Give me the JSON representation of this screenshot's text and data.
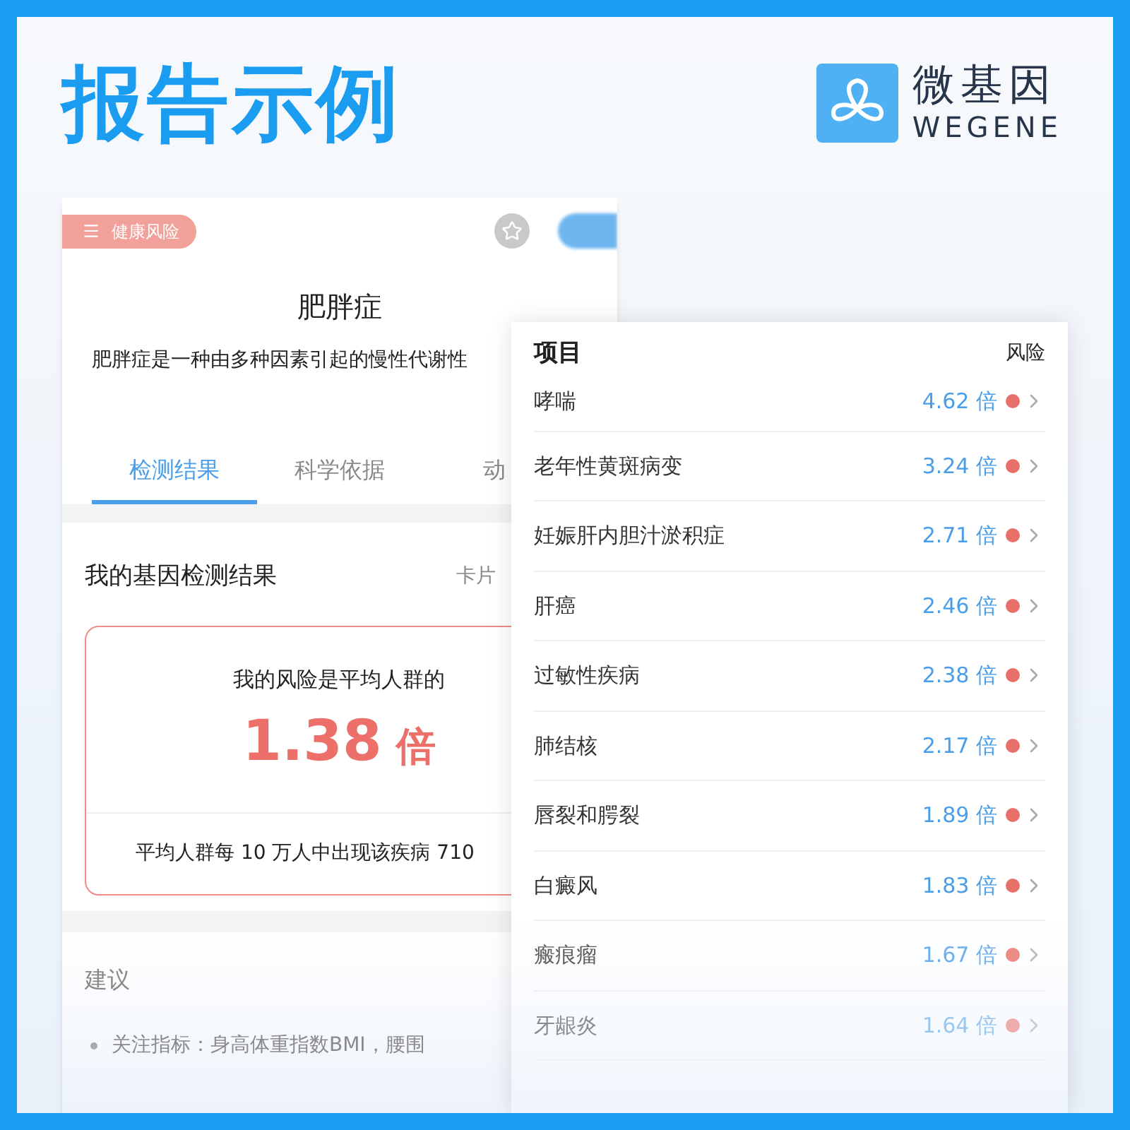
{
  "page_title": "报告示例",
  "logo": {
    "name": "微基因",
    "latin": "WEGENE"
  },
  "report": {
    "category": "健康风险",
    "title": "肥胖症",
    "description": "肥胖症是一种由多种因素引起的慢性代谢性",
    "tabs": [
      {
        "label": "检测结果",
        "selected": true
      },
      {
        "label": "科学依据",
        "selected": false
      },
      {
        "label": "动",
        "selected": false
      }
    ],
    "section": {
      "title": "我的基因检测结果",
      "action": "卡片"
    },
    "result": {
      "caption": "我的风险是平均人群的",
      "value": "1.38",
      "unit": "倍",
      "footnote": "平均人群每 10 万人中出现该疾病 710"
    },
    "advice": {
      "title": "建议",
      "bullets": [
        "关注指标：身高体重指数BMI，腰围"
      ]
    }
  },
  "risk_list": {
    "columns": [
      "项目",
      "风险"
    ],
    "rows": [
      {
        "name": "哮喘",
        "value": "4.62 倍"
      },
      {
        "name": "老年性黄斑病变",
        "value": "3.24 倍"
      },
      {
        "name": "妊娠肝内胆汁淤积症",
        "value": "2.71 倍"
      },
      {
        "name": "肝癌",
        "value": "2.46 倍"
      },
      {
        "name": "过敏性疾病",
        "value": "2.38 倍"
      },
      {
        "name": "肺结核",
        "value": "2.17 倍"
      },
      {
        "name": "唇裂和腭裂",
        "value": "1.89 倍"
      },
      {
        "name": "白癜风",
        "value": "1.83 倍"
      },
      {
        "name": "瘢痕瘤",
        "value": "1.67 倍"
      },
      {
        "name": "牙龈炎",
        "value": "1.64 倍"
      }
    ]
  }
}
